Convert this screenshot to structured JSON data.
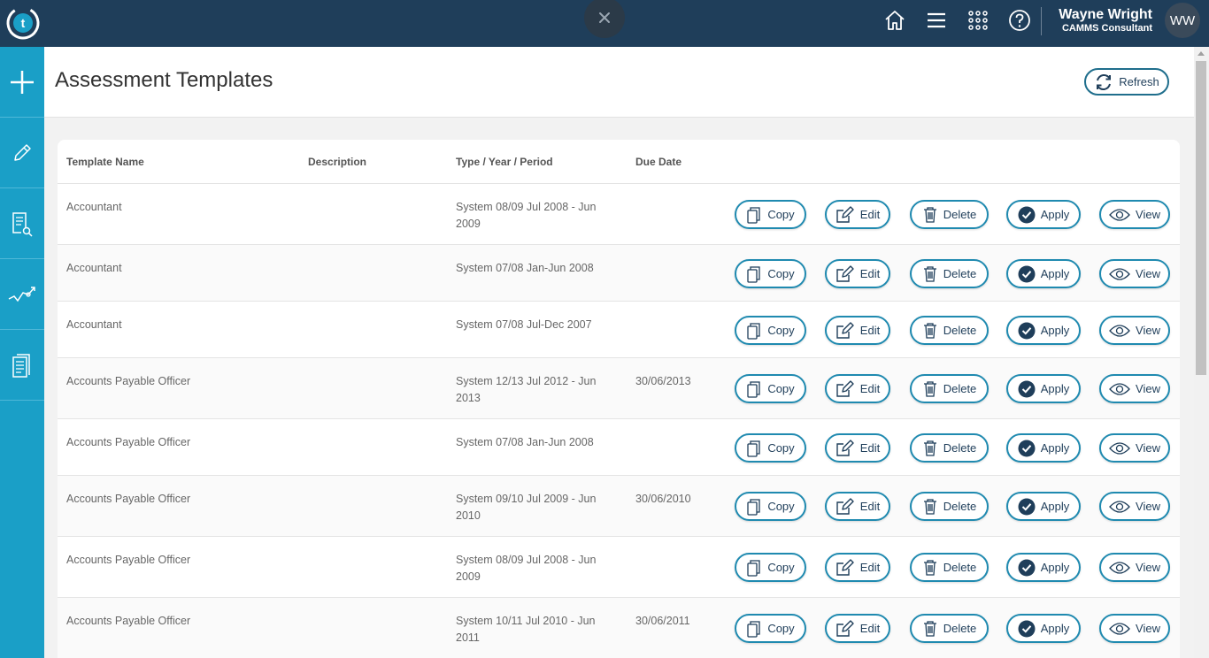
{
  "header": {
    "user_name": "Wayne Wright",
    "user_role": "CAMMS Consultant",
    "avatar_initials": "WW",
    "logo_letter": "t"
  },
  "page": {
    "title": "Assessment Templates",
    "refresh_label": "Refresh"
  },
  "table": {
    "columns": [
      "Template Name",
      "Description",
      "Type / Year / Period",
      "Due Date"
    ],
    "actions": {
      "copy": "Copy",
      "edit": "Edit",
      "delete": "Delete",
      "apply": "Apply",
      "view": "View"
    },
    "rows": [
      {
        "name": "Accountant",
        "description": "",
        "type": "System  08/09 Jul 2008 - Jun 2009",
        "due": ""
      },
      {
        "name": "Accountant",
        "description": "",
        "type": "System  07/08 Jan-Jun 2008",
        "due": ""
      },
      {
        "name": "Accountant",
        "description": "",
        "type": "System  07/08 Jul-Dec 2007",
        "due": ""
      },
      {
        "name": "Accounts Payable Officer",
        "description": "",
        "type": "System  12/13 Jul 2012 - Jun 2013",
        "due": "30/06/2013"
      },
      {
        "name": "Accounts Payable Officer",
        "description": "",
        "type": "System  07/08 Jan-Jun 2008",
        "due": ""
      },
      {
        "name": "Accounts Payable Officer",
        "description": "",
        "type": "System  09/10 Jul 2009 - Jun 2010",
        "due": "30/06/2010"
      },
      {
        "name": "Accounts Payable Officer",
        "description": "",
        "type": "System  08/09 Jul 2008 - Jun 2009",
        "due": ""
      },
      {
        "name": "Accounts Payable Officer",
        "description": "",
        "type": "System  10/11 Jul 2010 - Jun 2011",
        "due": "30/06/2011"
      }
    ]
  },
  "colors": {
    "topbar": "#1f3e5a",
    "sidebar": "#1a9fc7",
    "button_border": "#1f8ab0"
  },
  "icons": {
    "topbar": [
      "home-icon",
      "menu-icon",
      "apps-grid-icon",
      "help-icon"
    ],
    "sidebar": [
      "add-icon",
      "pencil-icon",
      "document-search-icon",
      "trend-chart-icon",
      "document-list-icon"
    ]
  }
}
